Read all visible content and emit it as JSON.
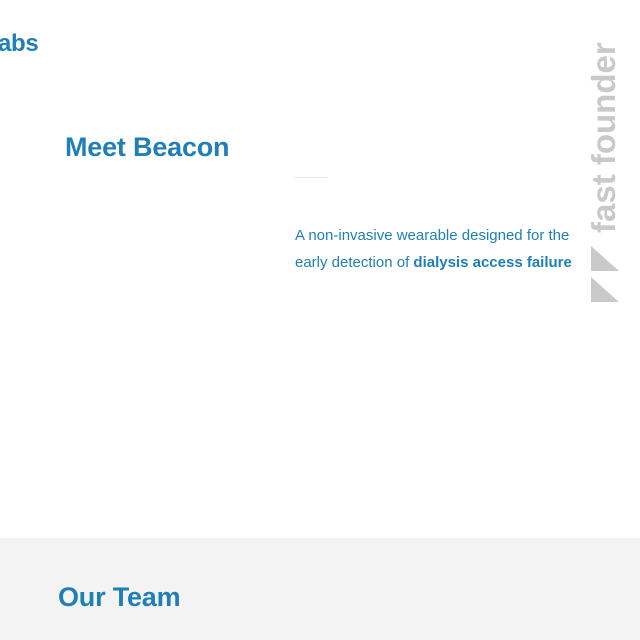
{
  "header": {
    "brand_text": "abs"
  },
  "hero": {
    "title": "Meet Beacon",
    "description_prefix": "A non-invasive wearable designed for the early detection of ",
    "description_highlight": "dialysis access failure"
  },
  "badge": {
    "label": "fast founder",
    "icon": "play-triangles-icon"
  },
  "team": {
    "title": "Our Team"
  },
  "colors": {
    "accent": "#1f7fb6",
    "badge_gray": "#c9c9c9",
    "section_bg": "#f3f3f3"
  }
}
